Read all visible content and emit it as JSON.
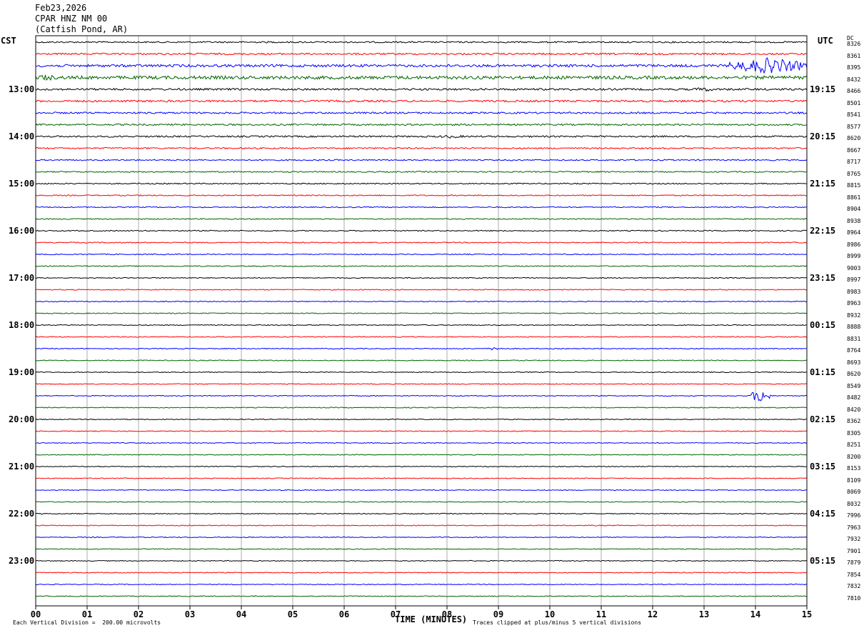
{
  "header": {
    "date": "Feb23,2026",
    "station": "CPAR HNZ NM 00",
    "location": "(Catfish Pond, AR)"
  },
  "left_zone": "CST",
  "right_zone": "UTC",
  "dc_label": "DC",
  "footer": {
    "scale_note": "Each Vertical Division =  200.00 microvolts",
    "x_title": "TIME (MINUTES)",
    "clip_note": "Traces clipped at plus/minus 5 vertical divisions"
  },
  "colors": {
    "trace_cycle": [
      "#000000",
      "#ff0000",
      "#0000ff",
      "#006400"
    ],
    "grid": "#888888"
  },
  "chart_data": {
    "type": "line",
    "xlabel": "TIME (MINUTES)",
    "xlim": [
      0,
      15
    ],
    "x_ticks": [
      "00",
      "01",
      "02",
      "03",
      "04",
      "05",
      "06",
      "07",
      "08",
      "09",
      "10",
      "11",
      "12",
      "13",
      "14",
      "15"
    ],
    "left_hour_labels": [
      "13:00",
      "14:00",
      "15:00",
      "16:00",
      "17:00",
      "18:00",
      "19:00",
      "20:00",
      "21:00",
      "22:00",
      "23:00"
    ],
    "right_hour_labels": [
      "19:15",
      "20:15",
      "21:15",
      "22:15",
      "23:15",
      "00:15",
      "01:15",
      "02:15",
      "03:15",
      "04:15",
      "05:15"
    ],
    "dc_offsets": [
      8326,
      8361,
      8395,
      8432,
      8466,
      8501,
      8541,
      8577,
      8620,
      8667,
      8717,
      8765,
      8815,
      8861,
      8904,
      8938,
      8964,
      8986,
      8999,
      9003,
      8997,
      8983,
      8963,
      8932,
      8888,
      8831,
      8764,
      8693,
      8620,
      8549,
      8482,
      8420,
      8362,
      8305,
      8251,
      8200,
      8153,
      8109,
      8069,
      8032,
      7996,
      7963,
      7932,
      7901,
      7879,
      7854,
      7832,
      7810
    ],
    "trace_amplitude": [
      0.45,
      0.55,
      0.8,
      1.0,
      0.6,
      0.6,
      0.55,
      0.5,
      0.5,
      0.45,
      0.4,
      0.38,
      0.36,
      0.34,
      0.33,
      0.32,
      0.32,
      0.31,
      0.3,
      0.3,
      0.28,
      0.28,
      0.28,
      0.28,
      0.27,
      0.27,
      0.27,
      0.27,
      0.27,
      0.27,
      0.27,
      0.27,
      0.26,
      0.26,
      0.26,
      0.26,
      0.26,
      0.26,
      0.26,
      0.26,
      0.26,
      0.26,
      0.26,
      0.26,
      0.26,
      0.26,
      0.26,
      0.26
    ],
    "events": [
      {
        "trace": 2,
        "start_min": 13.5,
        "end_min": 15,
        "amplitude": 5
      },
      {
        "trace": 3,
        "start_min": 0,
        "end_min": 0.4,
        "amplitude": 2.2
      },
      {
        "trace": 4,
        "start_min": 12.8,
        "end_min": 13.2,
        "amplitude": 1.5
      },
      {
        "trace": 8,
        "start_min": 7.8,
        "end_min": 8.4,
        "amplitude": 1.1
      },
      {
        "trace": 26,
        "start_min": 8.8,
        "end_min": 9.1,
        "amplitude": 1.2
      },
      {
        "trace": 30,
        "start_min": 13.9,
        "end_min": 14.3,
        "amplitude": 4.5
      }
    ]
  }
}
